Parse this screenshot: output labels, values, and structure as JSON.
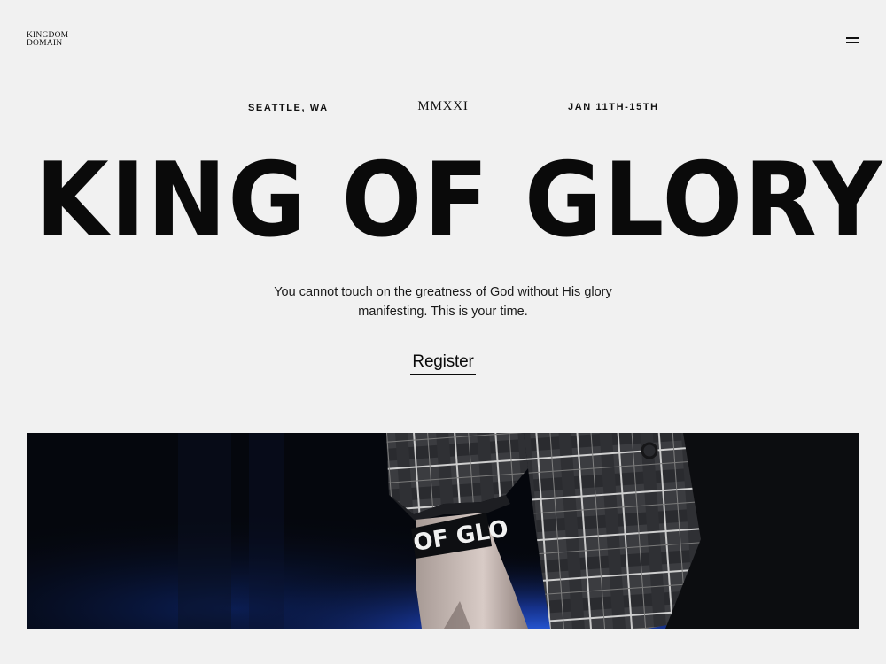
{
  "header": {
    "logo_line1": "KINGDOM",
    "logo_line2": "DOMAIN",
    "menu_icon": "hamburger-menu-icon"
  },
  "event": {
    "location": "SEATTLE, WA",
    "year": "MMXXI",
    "dates": "JAN 11TH-15TH"
  },
  "hero": {
    "title": "KING OF GLORY",
    "description_line1": "You cannot touch on the greatness of God without His glory",
    "description_line2": "manifesting. This is your time.",
    "cta_label": "Register",
    "image_wristband_text": "OF GLO"
  },
  "colors": {
    "background": "#f1f1f1",
    "text": "#0a0a0a",
    "stage_light": "#1f4fd1"
  }
}
